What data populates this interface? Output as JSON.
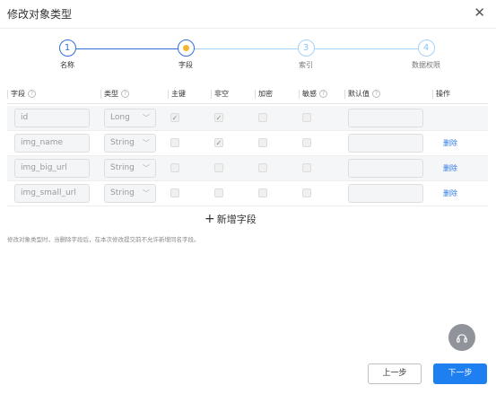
{
  "dialog": {
    "title": "修改对象类型",
    "close_icon": "close-icon"
  },
  "steps": [
    {
      "num": "1",
      "label": "名称",
      "state": "done"
    },
    {
      "num": "",
      "label": "字段",
      "state": "current"
    },
    {
      "num": "3",
      "label": "索引",
      "state": "wait"
    },
    {
      "num": "4",
      "label": "数据权限",
      "state": "wait"
    }
  ],
  "table": {
    "headers": {
      "field": "字段",
      "type": "类型",
      "pk": "主键",
      "notnull": "非空",
      "encrypt": "加密",
      "sensitive": "敏感",
      "default": "默认值",
      "action": "操作"
    },
    "help_icon": "question-circle-icon",
    "rows": [
      {
        "field": "id",
        "type": "Long",
        "pk": true,
        "notnull": true,
        "encrypt": false,
        "sensitive": false,
        "default": "",
        "action": ""
      },
      {
        "field": "img_name",
        "type": "String",
        "pk": false,
        "notnull": true,
        "encrypt": false,
        "sensitive": false,
        "default": "",
        "action": "删除"
      },
      {
        "field": "img_big_url",
        "type": "String",
        "pk": false,
        "notnull": false,
        "encrypt": false,
        "sensitive": false,
        "default": "",
        "action": "删除"
      },
      {
        "field": "img_small_url",
        "type": "String",
        "pk": false,
        "notnull": false,
        "encrypt": false,
        "sensitive": false,
        "default": "",
        "action": "删除"
      }
    ]
  },
  "add_field": {
    "label": "新增字段",
    "icon": "plus-icon"
  },
  "note": "修改对象类型时，当删除字段后，在本次修改提交前不允许新增同名字段。",
  "help_fab_icon": "headset-icon",
  "buttons": {
    "prev": "上一步",
    "next": "下一步"
  },
  "colors": {
    "primary": "#1e7ff0",
    "step_current_dot": "#f3b62c",
    "link": "#2f7ae5"
  }
}
